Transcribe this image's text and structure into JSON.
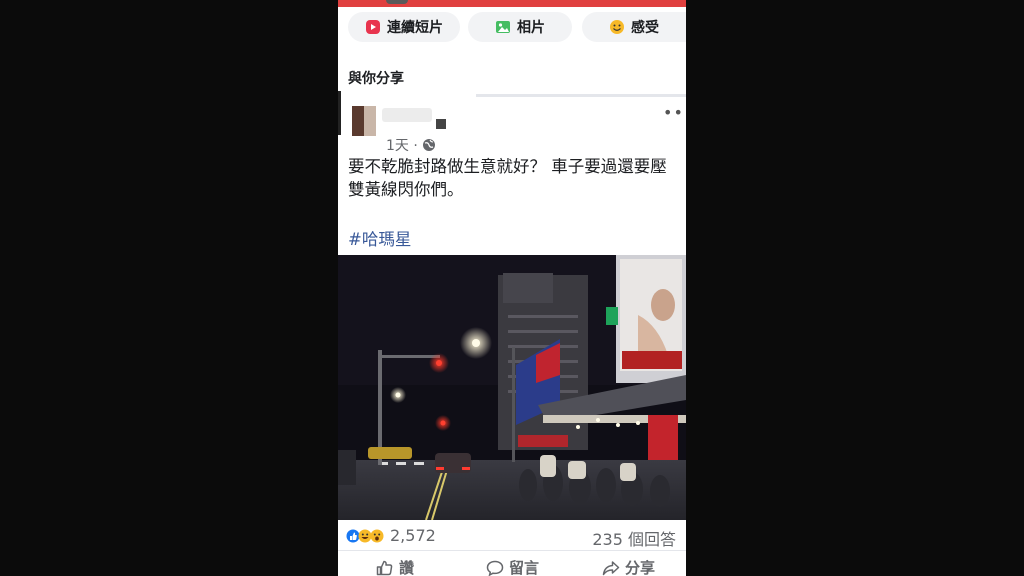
{
  "story_actions": [
    {
      "label": "連續短片",
      "icon": "reels-icon"
    },
    {
      "label": "相片",
      "icon": "photo-icon"
    },
    {
      "label": "感受",
      "icon": "smiley-icon"
    }
  ],
  "section_title": "與你分享",
  "post": {
    "time": "1天 ·",
    "text": "要不乾脆封路做生意就好？ 車子要過還要壓雙黃線閃你們。",
    "hashtag": "#哈瑪星",
    "photo_icon": "night-street-photo"
  },
  "stats": {
    "reactions": "2,572",
    "comments": "235 個回答"
  },
  "actions": {
    "like": "讚",
    "comment": "留言",
    "share": "分享"
  },
  "colors": {
    "accent": "#e0403f",
    "link": "#385898",
    "text": "#1c1e21",
    "muted": "#65676b"
  }
}
